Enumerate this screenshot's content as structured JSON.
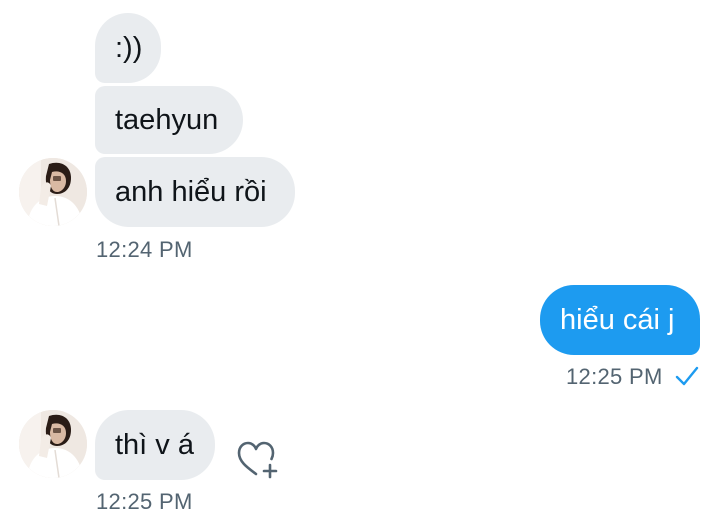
{
  "messages": {
    "incoming_group_1": [
      {
        "text": ":))"
      },
      {
        "text": "taehyun"
      },
      {
        "text": "anh hiểu rồi"
      }
    ],
    "incoming_group_1_time": "12:24 PM",
    "outgoing": {
      "text": "hiểu cái j",
      "time": "12:25 PM"
    },
    "incoming_group_2": [
      {
        "text": "thì v á"
      }
    ],
    "incoming_group_2_time": "12:25 PM"
  },
  "icons": {
    "read_receipt": "checkmark-icon",
    "react": "heart-add-icon"
  },
  "colors": {
    "outgoing_bubble": "#1d9bf0",
    "incoming_bubble": "#e9ecef",
    "timestamp": "#536471",
    "text": "#0f1419"
  }
}
